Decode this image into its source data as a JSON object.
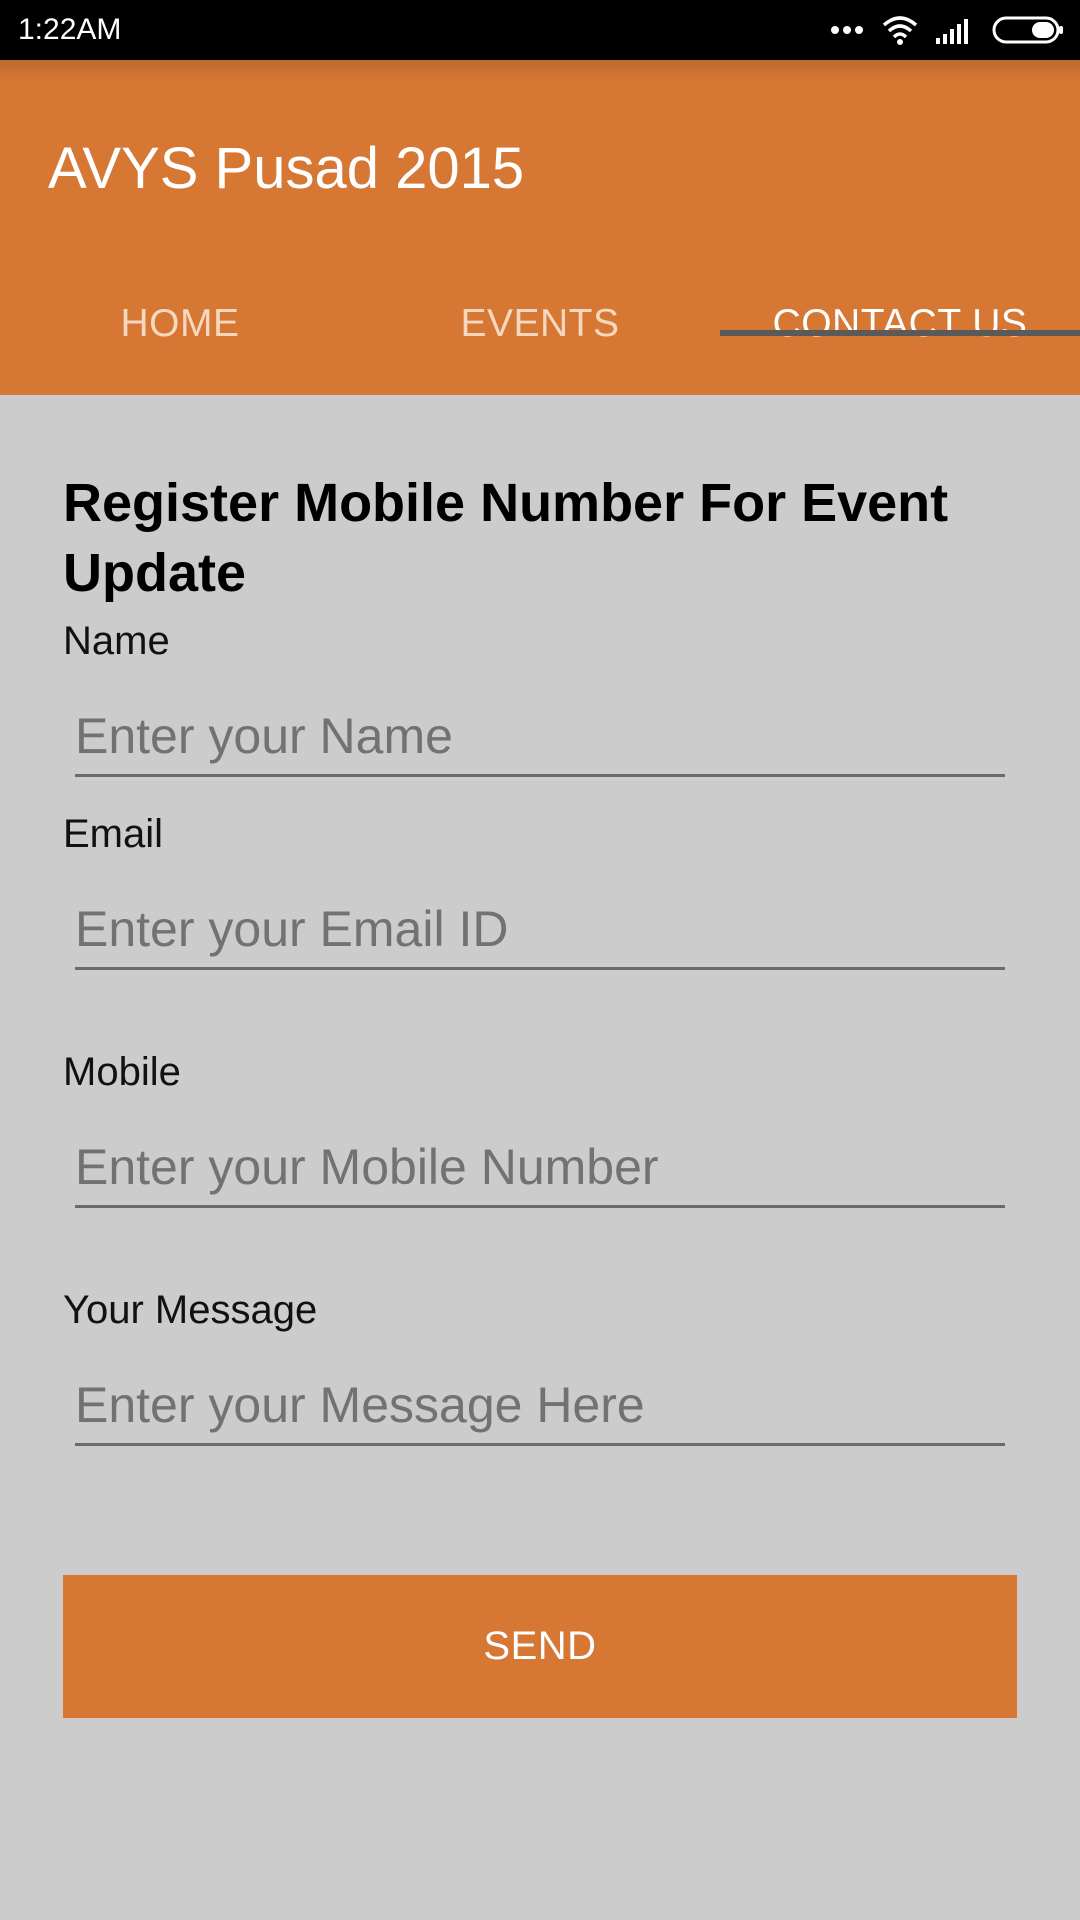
{
  "status_bar": {
    "time": "1:22AM",
    "icons": [
      "more-dots-icon",
      "wifi-icon",
      "signal-icon",
      "battery-icon"
    ]
  },
  "app": {
    "title": "AVYS Pusad 2015",
    "accent_color": "#d67834"
  },
  "tabs": [
    {
      "label": "HOME",
      "active": false
    },
    {
      "label": "EVENTS",
      "active": false
    },
    {
      "label": "CONTACT US",
      "active": true
    }
  ],
  "form": {
    "heading": "Register Mobile Number For Event Update",
    "fields": [
      {
        "label": "Name",
        "placeholder": "Enter your Name",
        "value": ""
      },
      {
        "label": "Email",
        "placeholder": "Enter your Email ID",
        "value": ""
      },
      {
        "label": "Mobile",
        "placeholder": "Enter your Mobile Number",
        "value": ""
      },
      {
        "label": "Your Message",
        "placeholder": "Enter your Message Here",
        "value": ""
      }
    ],
    "submit_label": "SEND"
  }
}
